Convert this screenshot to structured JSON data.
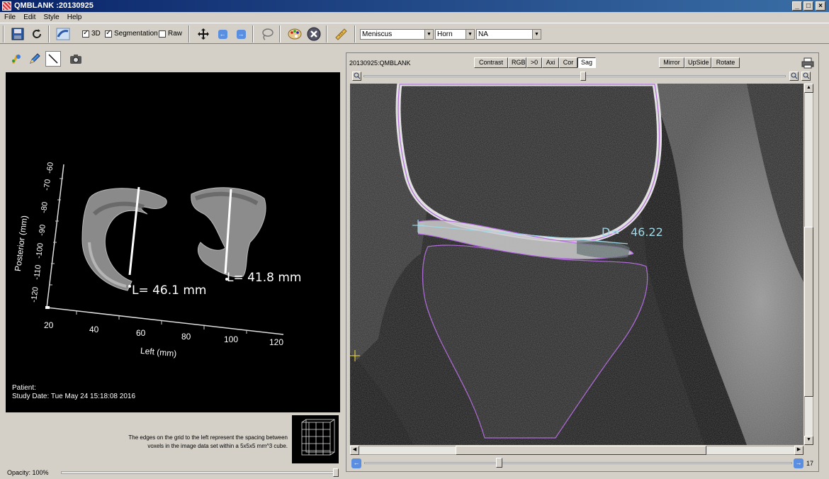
{
  "window": {
    "title": "QMBLANK :20130925"
  },
  "menu": [
    "File",
    "Edit",
    "Style",
    "Help"
  ],
  "toolbar": {
    "check_3d": "3D",
    "check_segmentation": "Segmentation",
    "check_raw": "Raw",
    "combo_structure": "Meniscus",
    "combo_region": "Horn",
    "combo_extra": "NA"
  },
  "view3d": {
    "measure_1": "L= 46.1 mm",
    "measure_2": "L= 41.8 mm",
    "axis_x_label": "Left (mm)",
    "axis_y_label": "Posterior (mm)",
    "x_ticks": [
      "20",
      "40",
      "60",
      "80",
      "100",
      "120"
    ],
    "y_ticks": [
      "-120",
      "-110",
      "-100",
      "-90",
      "-80",
      "-70",
      "-60"
    ],
    "patient_label": "Patient:",
    "study_date": "Study Date: Tue May 24 15:18:08 2016"
  },
  "info": {
    "text_line1": "The edges on the grid to the left represent the spacing between",
    "text_line2": "voxels in the image data set within a 5x5x5 mm^3 cube.",
    "opacity": "Opacity: 100%"
  },
  "slice_view": {
    "series_label": "20130925:QMBLANK",
    "buttons": [
      "Contrast",
      "RGB",
      ">0",
      "Axi",
      "Cor",
      "Sag"
    ],
    "active_button": "Sag",
    "buttons_right": [
      "Mirror",
      "UpSide",
      "Rotate"
    ],
    "measure": "D=   46.22",
    "slice_number": "17"
  },
  "colors": {
    "titlebar": "#0a246a",
    "segmentation": "#a050e0",
    "measure_line": "#9fd7e6"
  }
}
